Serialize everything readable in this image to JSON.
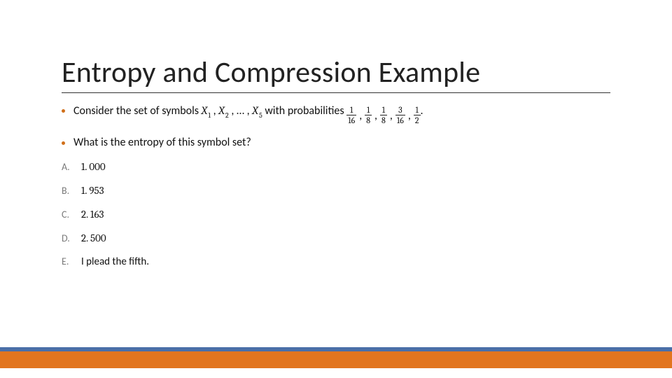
{
  "title": "Entropy and Compression Example",
  "intro": {
    "prefix": "Consider the set of symbols ",
    "symbol_base": "X",
    "symbol_sub1": "1",
    "comma1": ", ",
    "symbol_sub2": "2",
    "comma2": ", … , ",
    "symbol_sub5": "5",
    "mid": " with probabilities ",
    "end": "."
  },
  "probs": [
    {
      "num": "1",
      "den": "16"
    },
    {
      "num": "1",
      "den": "8"
    },
    {
      "num": "1",
      "den": "8"
    },
    {
      "num": "3",
      "den": "16"
    },
    {
      "num": "1",
      "den": "2"
    }
  ],
  "question": "What is the entropy of this symbol set?",
  "options": [
    {
      "label": "A.",
      "value": "1. 000"
    },
    {
      "label": "B.",
      "value": "1. 953"
    },
    {
      "label": "C.",
      "value": "2. 163"
    },
    {
      "label": "D.",
      "value": "2. 500"
    },
    {
      "label": "E.",
      "value": "I plead the fifth."
    }
  ],
  "colors": {
    "accent_orange": "#e2751f",
    "accent_blue": "#4a6fa8"
  }
}
